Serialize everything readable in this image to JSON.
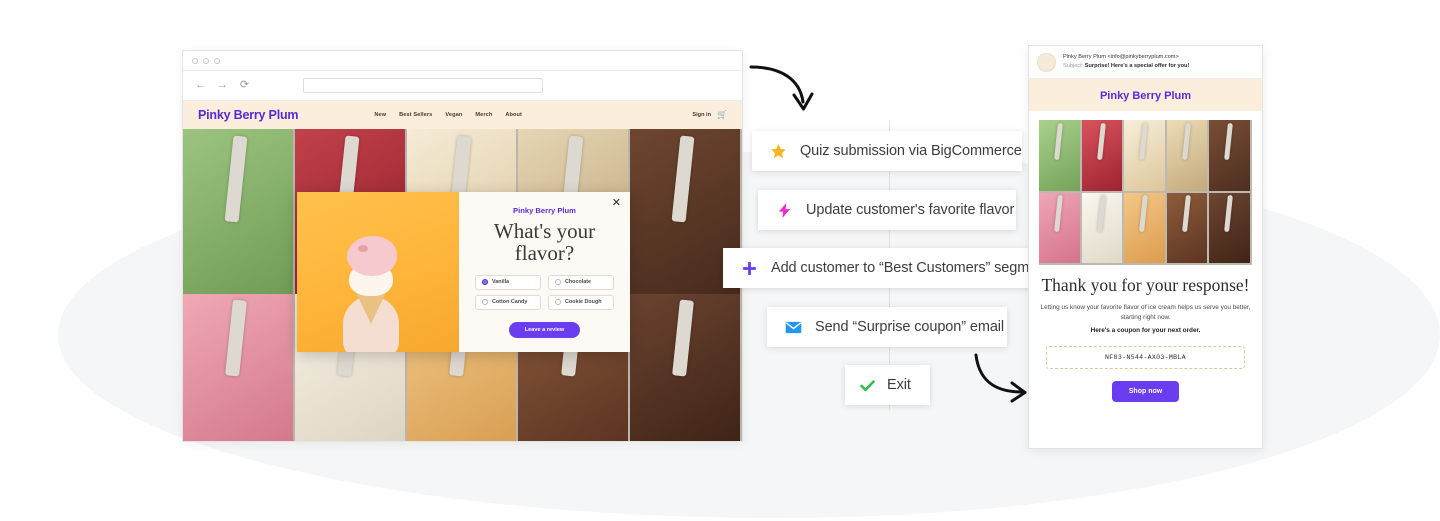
{
  "browser": {
    "nav": {
      "back": "←",
      "forward": "→",
      "reload": "⟳"
    },
    "url_value": "",
    "url_placeholder": ""
  },
  "site": {
    "brand": "Pinky Berry Plum",
    "nav_items": [
      "New",
      "Best Sellers",
      "Vegan",
      "Merch",
      "About"
    ],
    "sign_in": "Sign in",
    "cart_icon": "cart-icon"
  },
  "modal": {
    "close_label": "✕",
    "brand": "Pinky Berry Plum",
    "title": "What's your flavor?",
    "options": [
      {
        "label": "Vanilla",
        "selected": true
      },
      {
        "label": "Chocolate",
        "selected": false
      },
      {
        "label": "Cotton Candy",
        "selected": false
      },
      {
        "label": "Cookie Dough",
        "selected": false
      }
    ],
    "cta": "Leave a review"
  },
  "flow": {
    "steps": [
      {
        "label": "Quiz submission via BigCommerce",
        "icon": "star-icon",
        "color": "#f5b722"
      },
      {
        "label": "Update customer's favorite flavor",
        "icon": "lightning-bolt-icon",
        "color": "#ef2bc8"
      },
      {
        "label": "Add customer to “Best Customers” segment",
        "icon": "plus-icon",
        "color": "#6a3df0"
      },
      {
        "label": "Send “Surprise coupon” email",
        "icon": "envelope-icon",
        "color": "#2196f3"
      },
      {
        "label": "Exit",
        "icon": "check-icon",
        "color": "#2fbf4f"
      }
    ]
  },
  "email": {
    "from": "Pinky Berry Plum <info@pinkyberryplum.com>",
    "subject_label": "Subject:",
    "subject": "Surprise! Here's a special offer for you!",
    "brand": "Pinky Berry Plum",
    "title": "Thank you for your response!",
    "body": "Letting us know your favorite flavor of ice cream helps us serve you better, starting right now.",
    "body_bold": "Here's a coupon for your next order.",
    "coupon_code": "NF83-N544-AX03-MBLA",
    "cta": "Shop now"
  },
  "theme": {
    "purple": "#6a3df0",
    "cream": "#fbeedd",
    "blob": "#f3f4f6"
  }
}
